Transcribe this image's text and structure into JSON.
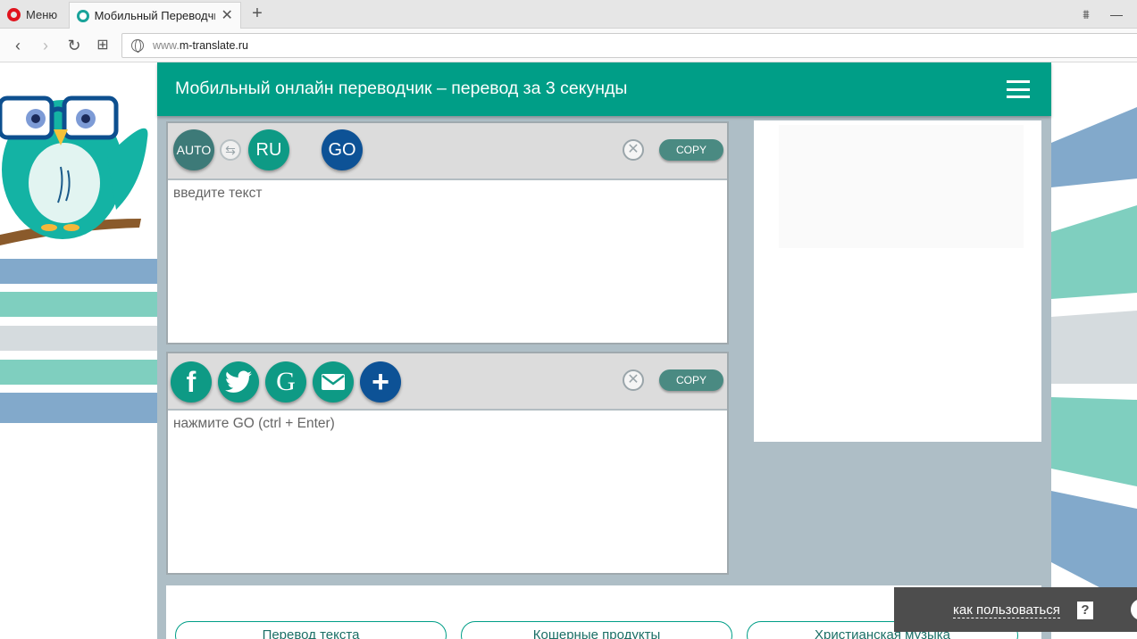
{
  "browser": {
    "menu_label": "Меню",
    "tab_title": "Мобильный Переводчик",
    "new_tab_symbol": "+",
    "tab_close_symbol": "✕",
    "url_prefix": "www.",
    "url_domain": "m-translate.ru",
    "nav": {
      "back": "‹",
      "forward": "›",
      "reload": "↻",
      "tiles": "⊞"
    },
    "window": {
      "tabmenu": "⩩",
      "minimize": "—"
    }
  },
  "header": {
    "title": "Мобильный онлайн переводчик – перевод за 3 секунды"
  },
  "source_panel": {
    "source_lang": "AUTO",
    "swap_symbol": "⇆",
    "target_lang": "RU",
    "go_label": "GO",
    "clear_symbol": "✕",
    "copy_label": "COPY",
    "placeholder": "введите текст"
  },
  "result_panel": {
    "share_buttons": [
      {
        "icon": "facebook-icon",
        "glyph": "f"
      },
      {
        "icon": "twitter-icon",
        "glyph": ""
      },
      {
        "icon": "google-icon",
        "glyph": "G"
      },
      {
        "icon": "email-icon",
        "glyph": ""
      },
      {
        "icon": "plus-icon",
        "glyph": "+"
      }
    ],
    "clear_symbol": "✕",
    "copy_label": "COPY",
    "placeholder": "нажмите GO (ctrl + Enter)"
  },
  "links": [
    "Перевод текста",
    "Кошерные продукты",
    "Христианская музыка"
  ],
  "howto": {
    "label": "как пользоваться",
    "question_mark": "?"
  },
  "colors": {
    "header": "#009e87",
    "panel_bg": "#aebec6",
    "auto_button": "#3d7a78",
    "ru_button": "#0e9a85",
    "go_button": "#0d5296",
    "share_teal": "#0e9a85",
    "share_blue": "#0d5296",
    "stripe_blue": "#82a9cb",
    "stripe_teal": "#7fcfbf",
    "stripe_gray": "#d5dbde"
  }
}
